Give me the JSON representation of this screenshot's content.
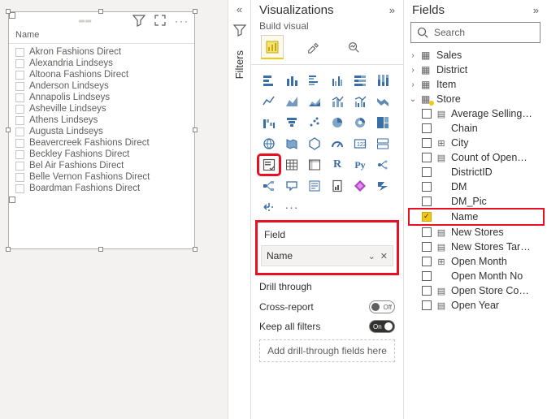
{
  "slicer": {
    "header_label": "Name",
    "items": [
      "Akron Fashions Direct",
      "Alexandria Lindseys",
      "Altoona Fashions Direct",
      "Anderson Lindseys",
      "Annapolis Lindseys",
      "Asheville Lindseys",
      "Athens Lindseys",
      "Augusta Lindseys",
      "Beavercreek Fashions Direct",
      "Beckley Fashions Direct",
      "Bel Air Fashions Direct",
      "Belle Vernon Fashions Direct",
      "Boardman Fashions Direct"
    ]
  },
  "filters_pane_label": "Filters",
  "viz_pane": {
    "title": "Visualizations",
    "subtitle": "Build visual",
    "field_section_label": "Field",
    "field_well_value": "Name",
    "drill_title": "Drill through",
    "cross_report_label": "Cross-report",
    "cross_report_toggle": "Off",
    "keep_filters_label": "Keep all filters",
    "keep_filters_toggle": "On",
    "drill_placeholder": "Add drill-through fields here",
    "r_label": "R",
    "py_label": "Py",
    "more_label": "···"
  },
  "fields_pane": {
    "title": "Fields",
    "search_placeholder": "Search",
    "tables": {
      "sales": "Sales",
      "district": "District",
      "item": "Item",
      "store": "Store"
    },
    "store_fields": [
      "Average Selling…",
      "Chain",
      "City",
      "Count of Open…",
      "DistrictID",
      "DM",
      "DM_Pic",
      "Name",
      "New Stores",
      "New Stores Tar…",
      "Open Month",
      "Open Month No",
      "Open Store Co…",
      "Open Year"
    ]
  }
}
